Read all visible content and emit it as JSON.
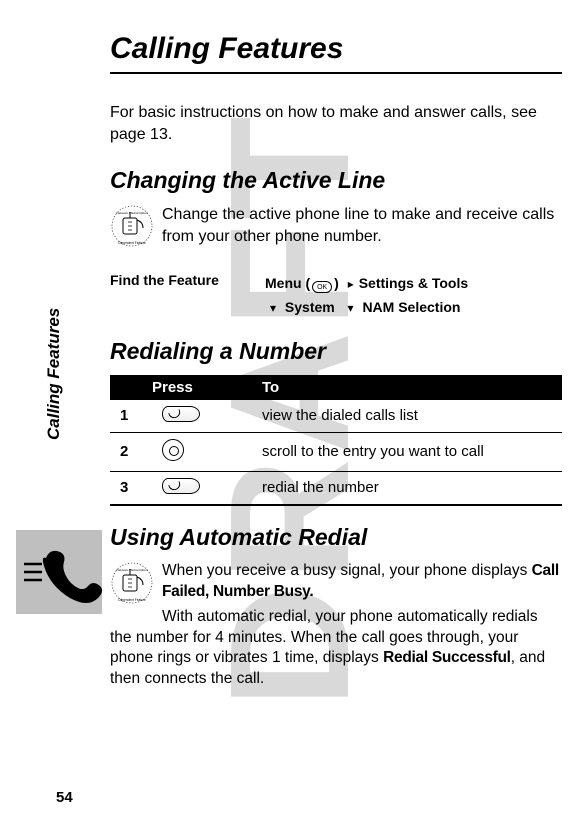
{
  "watermark": "DRAFT",
  "sidebar_label": "Calling Features",
  "page_number": "54",
  "title": "Calling Features",
  "intro": "For basic instructions on how to make and answer calls, see page 13.",
  "sections": {
    "changing": {
      "heading": "Changing the Active Line",
      "body": "Change the active phone line to make and receive calls from your other phone number.",
      "ftf_label": "Find the Feature",
      "menu_word": "Menu",
      "menu_key_text": "OK",
      "path": {
        "p1": "Settings & Tools",
        "p2": "System",
        "p3": "NAM Selection"
      }
    },
    "redial": {
      "heading": "Redialing a Number",
      "table": {
        "head_press": "Press",
        "head_to": "To",
        "rows": [
          {
            "n": "1",
            "key": "send",
            "to": "view the dialed calls list"
          },
          {
            "n": "2",
            "key": "nav",
            "to": "scroll to the entry you want to call"
          },
          {
            "n": "3",
            "key": "send",
            "to": "redial the number"
          }
        ]
      }
    },
    "auto": {
      "heading": "Using Automatic Redial",
      "lead": "When you receive a busy signal, your phone displays ",
      "lead_bold": "Call Failed, Number Busy.",
      "body_a": "With automatic redial, your phone automatically redials the number for 4 minutes. When the call goes through, your phone rings or vibrates 1 time, displays ",
      "body_bold": "Redial Successful",
      "body_b": ", and then connects the call."
    }
  }
}
